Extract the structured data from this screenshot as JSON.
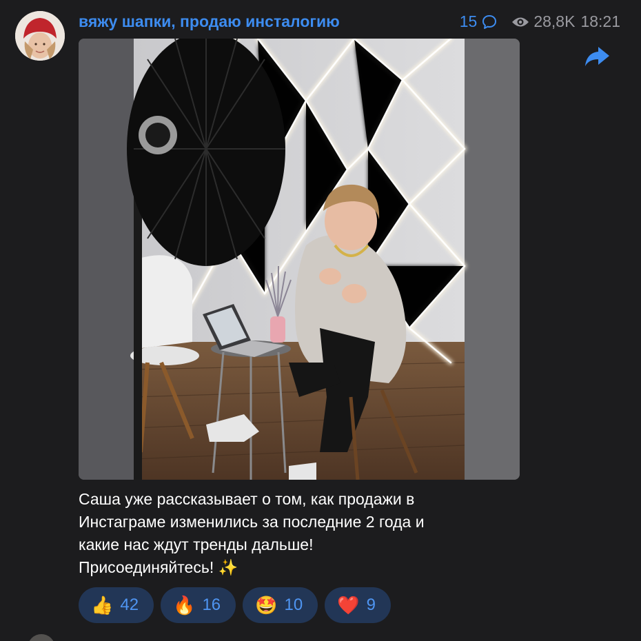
{
  "post": {
    "channel_title": "вяжу шапки, продаю инсталогию",
    "comments_count": "15",
    "views": "28,8K",
    "time": "18:21",
    "caption_lines": [
      "Саша уже рассказывает о том, как продажи в",
      "Инстаграме изменились за последние 2 года и",
      "какие нас ждут тренды дальше!",
      "Присоединяйтесь! ✨"
    ],
    "reactions": [
      {
        "emoji": "👍",
        "count": "42"
      },
      {
        "emoji": "🔥",
        "count": "16"
      },
      {
        "emoji": "🤩",
        "count": "10"
      },
      {
        "emoji": "❤️",
        "count": "9"
      }
    ]
  },
  "icons": {
    "comment": "comment-bubble-icon",
    "views": "eye-icon",
    "forward": "forward-arrow-icon"
  },
  "colors": {
    "background": "#1c1c1e",
    "accent": "#3d8cf0",
    "reaction_bg": "#223656",
    "muted": "#9a9aa0"
  }
}
